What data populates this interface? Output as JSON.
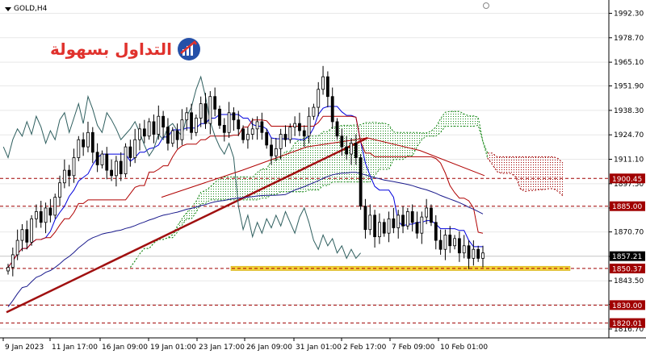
{
  "window": {
    "title": "GOLD,H4"
  },
  "brand": {
    "name": "التداول بسهولة"
  },
  "colors": {
    "grid_line": "#e8e8e8",
    "level_line": "#a00000",
    "trend_line": "#a01010",
    "tenkan": "#0000dd",
    "kijun": "#b00000",
    "chikou": "#2f5f5f",
    "cloud_bull": "#1a8a1a",
    "cloud_bear": "#a00000",
    "support_band": "#f3d23a",
    "badge_dark": "#000000",
    "badge_red": "#a00000",
    "brand_red": "#e0322d",
    "brand_blue": "#2550a8"
  },
  "chart_data": {
    "type": "candlestick",
    "symbol": "GOLD",
    "timeframe": "H4",
    "ylim": [
      1816.7,
      1997.0
    ],
    "y_ticks": [
      1992.3,
      1978.7,
      1965.1,
      1951.9,
      1938.3,
      1924.7,
      1911.1,
      1897.5,
      1884.0,
      1870.7,
      1857.1,
      1843.5,
      1830.3,
      1816.7
    ],
    "y_tick_labels": [
      "1992.30",
      "1978.70",
      "1965.10",
      "1951.90",
      "1938.30",
      "1924.70",
      "1911.10",
      "1897.50",
      "1884.00",
      "1870.70",
      "1857.10",
      "1843.50",
      "1830.30",
      "1816.70"
    ],
    "x_tick_labels": [
      "9 Jan 2023",
      "11 Jan 17:00",
      "16 Jan 09:00",
      "19 Jan 01:00",
      "23 Jan 17:00",
      "26 Jan 09:00",
      "31 Jan 01:00",
      "2 Feb 17:00",
      "7 Feb 09:00",
      "10 Feb 01:00"
    ],
    "levels": [
      {
        "value": 1900.45,
        "label": "1900.45"
      },
      {
        "value": 1885.0,
        "label": "1885.00"
      },
      {
        "value": 1850.37,
        "label": "1850.37"
      },
      {
        "value": 1830.0,
        "label": "1830.00"
      },
      {
        "value": 1820.01,
        "label": "1820.01"
      }
    ],
    "current_price": {
      "value": 1857.21,
      "label": "1857.21"
    },
    "closes": [
      1851,
      1858,
      1866,
      1872,
      1865,
      1878,
      1882,
      1876,
      1884,
      1880,
      1890,
      1898,
      1905,
      1902,
      1912,
      1922,
      1918,
      1926,
      1915,
      1908,
      1914,
      1905,
      1902,
      1910,
      1903,
      1918,
      1912,
      1922,
      1928,
      1924,
      1932,
      1925,
      1935,
      1929,
      1920,
      1927,
      1922,
      1933,
      1937,
      1926,
      1934,
      1942,
      1931,
      1946,
      1939,
      1930,
      1926,
      1937,
      1933,
      1928,
      1922,
      1925,
      1928,
      1932,
      1926,
      1919,
      1913,
      1917,
      1925,
      1922,
      1929,
      1931,
      1927,
      1924,
      1935,
      1940,
      1950,
      1957,
      1946,
      1932,
      1924,
      1918,
      1914,
      1920,
      1912,
      1885,
      1872,
      1880,
      1868,
      1876,
      1870,
      1878,
      1873,
      1880,
      1874,
      1882,
      1876,
      1870,
      1879,
      1884,
      1876,
      1866,
      1861,
      1869,
      1863,
      1867,
      1859,
      1863,
      1856,
      1861,
      1856,
      1859
    ]
  }
}
